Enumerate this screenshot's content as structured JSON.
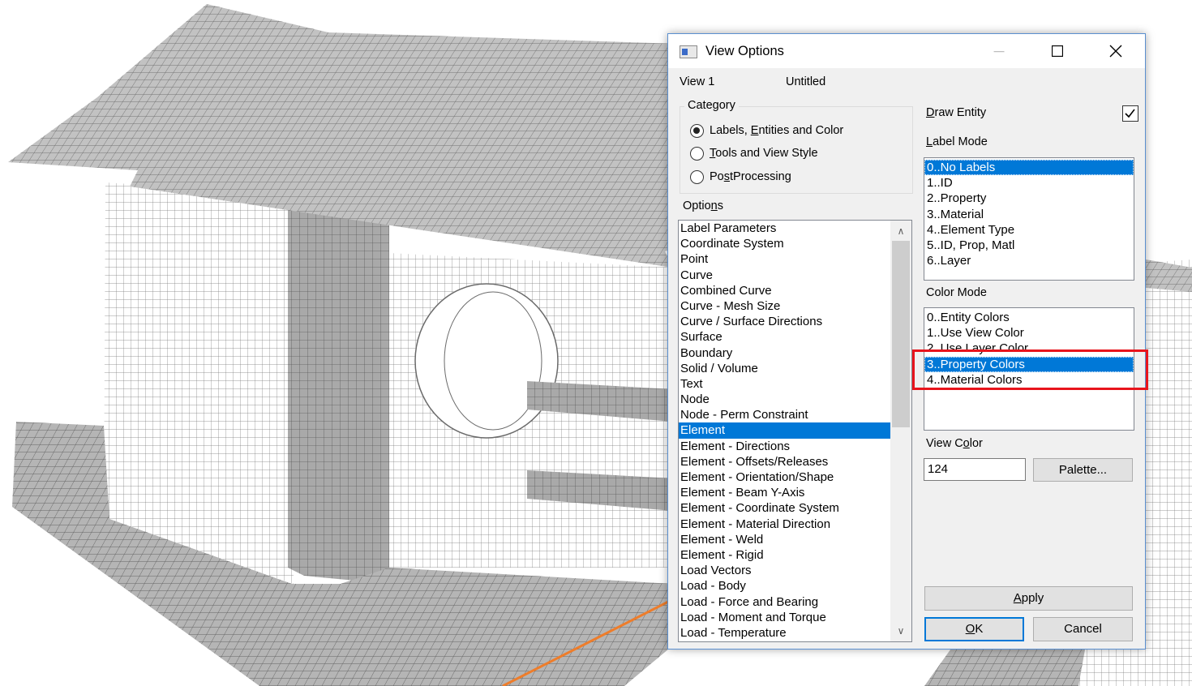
{
  "dialog": {
    "title": "View Options",
    "view_label": "View  1",
    "view_name": "Untitled",
    "category": {
      "legend": "Category",
      "options": [
        {
          "pre": "",
          "key": "",
          "post": "Labels, ",
          "key2": "E",
          "post2": "ntities and Color",
          "selected": true
        },
        {
          "pre": "",
          "key": "T",
          "post": "ools and View Style",
          "key2": "",
          "post2": "",
          "selected": false
        },
        {
          "pre": "Po",
          "key": "s",
          "post": "tProcessing",
          "key2": "",
          "post2": "",
          "selected": false
        }
      ]
    },
    "options_label": {
      "pre": "Optio",
      "key": "n",
      "post": "s"
    },
    "options_list": [
      "Label Parameters",
      "Coordinate System",
      "Point",
      "Curve",
      "Combined Curve",
      "Curve - Mesh Size",
      "Curve / Surface Directions",
      "Surface",
      "Boundary",
      "Solid / Volume",
      "Text",
      "Node",
      "Node - Perm Constraint",
      "Element",
      "Element - Directions",
      "Element - Offsets/Releases",
      "Element - Orientation/Shape",
      "Element - Beam Y-Axis",
      "Element - Coordinate System",
      "Element - Material Direction",
      "Element - Weld",
      "Element - Rigid",
      "Load Vectors",
      "Load - Body",
      "Load - Force and Bearing",
      "Load - Moment and Torque",
      "Load - Temperature"
    ],
    "options_selected_index": 13,
    "draw_entity": {
      "key": "D",
      "rest": "raw Entity",
      "checked": true
    },
    "label_mode": {
      "label_key": "L",
      "label_rest": "abel Mode",
      "items": [
        "0..No Labels",
        "1..ID",
        "2..Property",
        "3..Material",
        "4..Element Type",
        "5..ID, Prop, Matl",
        "6..Layer"
      ],
      "selected_index": 0
    },
    "color_mode": {
      "label": "Color Mode",
      "items": [
        "0..Entity Colors",
        "1..Use View Color",
        "2..Use Layer Color",
        "3..Property Colors",
        "4..Material Colors"
      ],
      "selected_index": 3
    },
    "view_color": {
      "label_pre": "View C",
      "label_key": "o",
      "label_post": "lor",
      "value": "124"
    },
    "buttons": {
      "palette": "Palette...",
      "apply_key": "A",
      "apply_rest": "pply",
      "ok_key": "O",
      "ok_rest": "K",
      "cancel": "Cancel"
    }
  },
  "colors": {
    "accent": "#0078d7",
    "highlight_box": "#e8141c",
    "arrow": "#ee7d2b",
    "mesh_fill": "#c4c4c4",
    "mesh_line": "#6e6e6e"
  }
}
